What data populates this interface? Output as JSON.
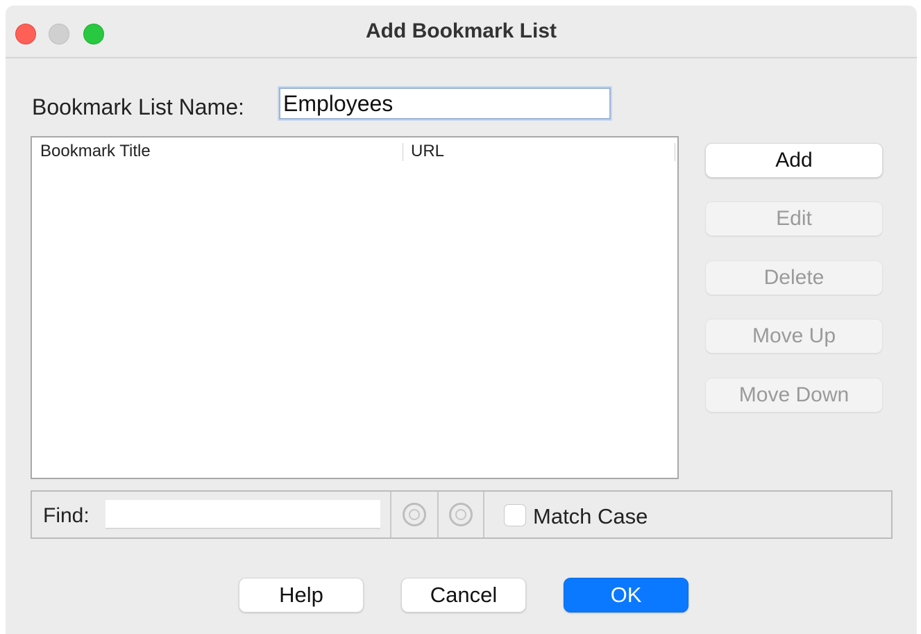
{
  "window": {
    "title": "Add Bookmark List"
  },
  "form": {
    "name_label": "Bookmark List Name:",
    "name_value": "Employees"
  },
  "table": {
    "columns": [
      "Bookmark Title",
      "URL"
    ],
    "rows": []
  },
  "side_buttons": {
    "add": "Add",
    "edit": "Edit",
    "delete": "Delete",
    "move_up": "Move Up",
    "move_down": "Move Down"
  },
  "find_bar": {
    "label": "Find:",
    "value": "",
    "match_case_label": "Match Case",
    "match_case_checked": false
  },
  "footer": {
    "help": "Help",
    "cancel": "Cancel",
    "ok": "OK"
  },
  "colors": {
    "primary_button": "#0a78ff",
    "close": "#fe5f57",
    "maximize": "#28c840",
    "minimize": "#d0d0d0"
  }
}
